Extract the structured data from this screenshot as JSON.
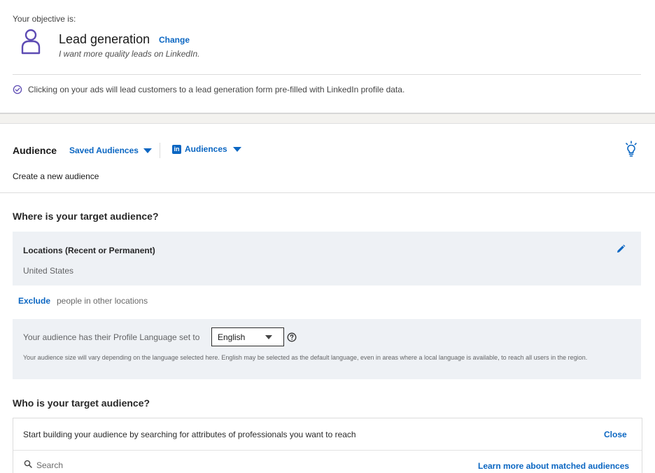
{
  "objective": {
    "label": "Your objective is:",
    "icon": "person-outline-icon",
    "title": "Lead generation",
    "change_label": "Change",
    "subtitle": "I want more quality leads on LinkedIn.",
    "note": "Clicking on your ads will lead customers to a lead generation form pre-filled with LinkedIn profile data."
  },
  "audience": {
    "label": "Audience",
    "saved_audiences_label": "Saved Audiences",
    "linkedin_audiences_label": "Audiences",
    "create_new": "Create a new audience"
  },
  "where": {
    "heading": "Where is your target audience?",
    "locations_title": "Locations (Recent or Permanent)",
    "locations_value": "United States",
    "exclude_label": "Exclude",
    "exclude_text": "people in other locations"
  },
  "language": {
    "prefix": "Your audience has their Profile Language set to",
    "selected": "English",
    "note": "Your audience size will vary depending on the language selected here. English may be selected as the default language, even in areas where a local language is available, to reach all users in the region."
  },
  "who": {
    "heading": "Who is your target audience?",
    "prompt": "Start building your audience by searching for attributes of professionals you want to reach",
    "close_label": "Close",
    "search_placeholder": "Search",
    "learn_more_label": "Learn more about matched audiences"
  },
  "colors": {
    "accent": "#0a66c2",
    "icon_purple": "#5d4bb3",
    "panel_bg": "#eef1f5"
  }
}
